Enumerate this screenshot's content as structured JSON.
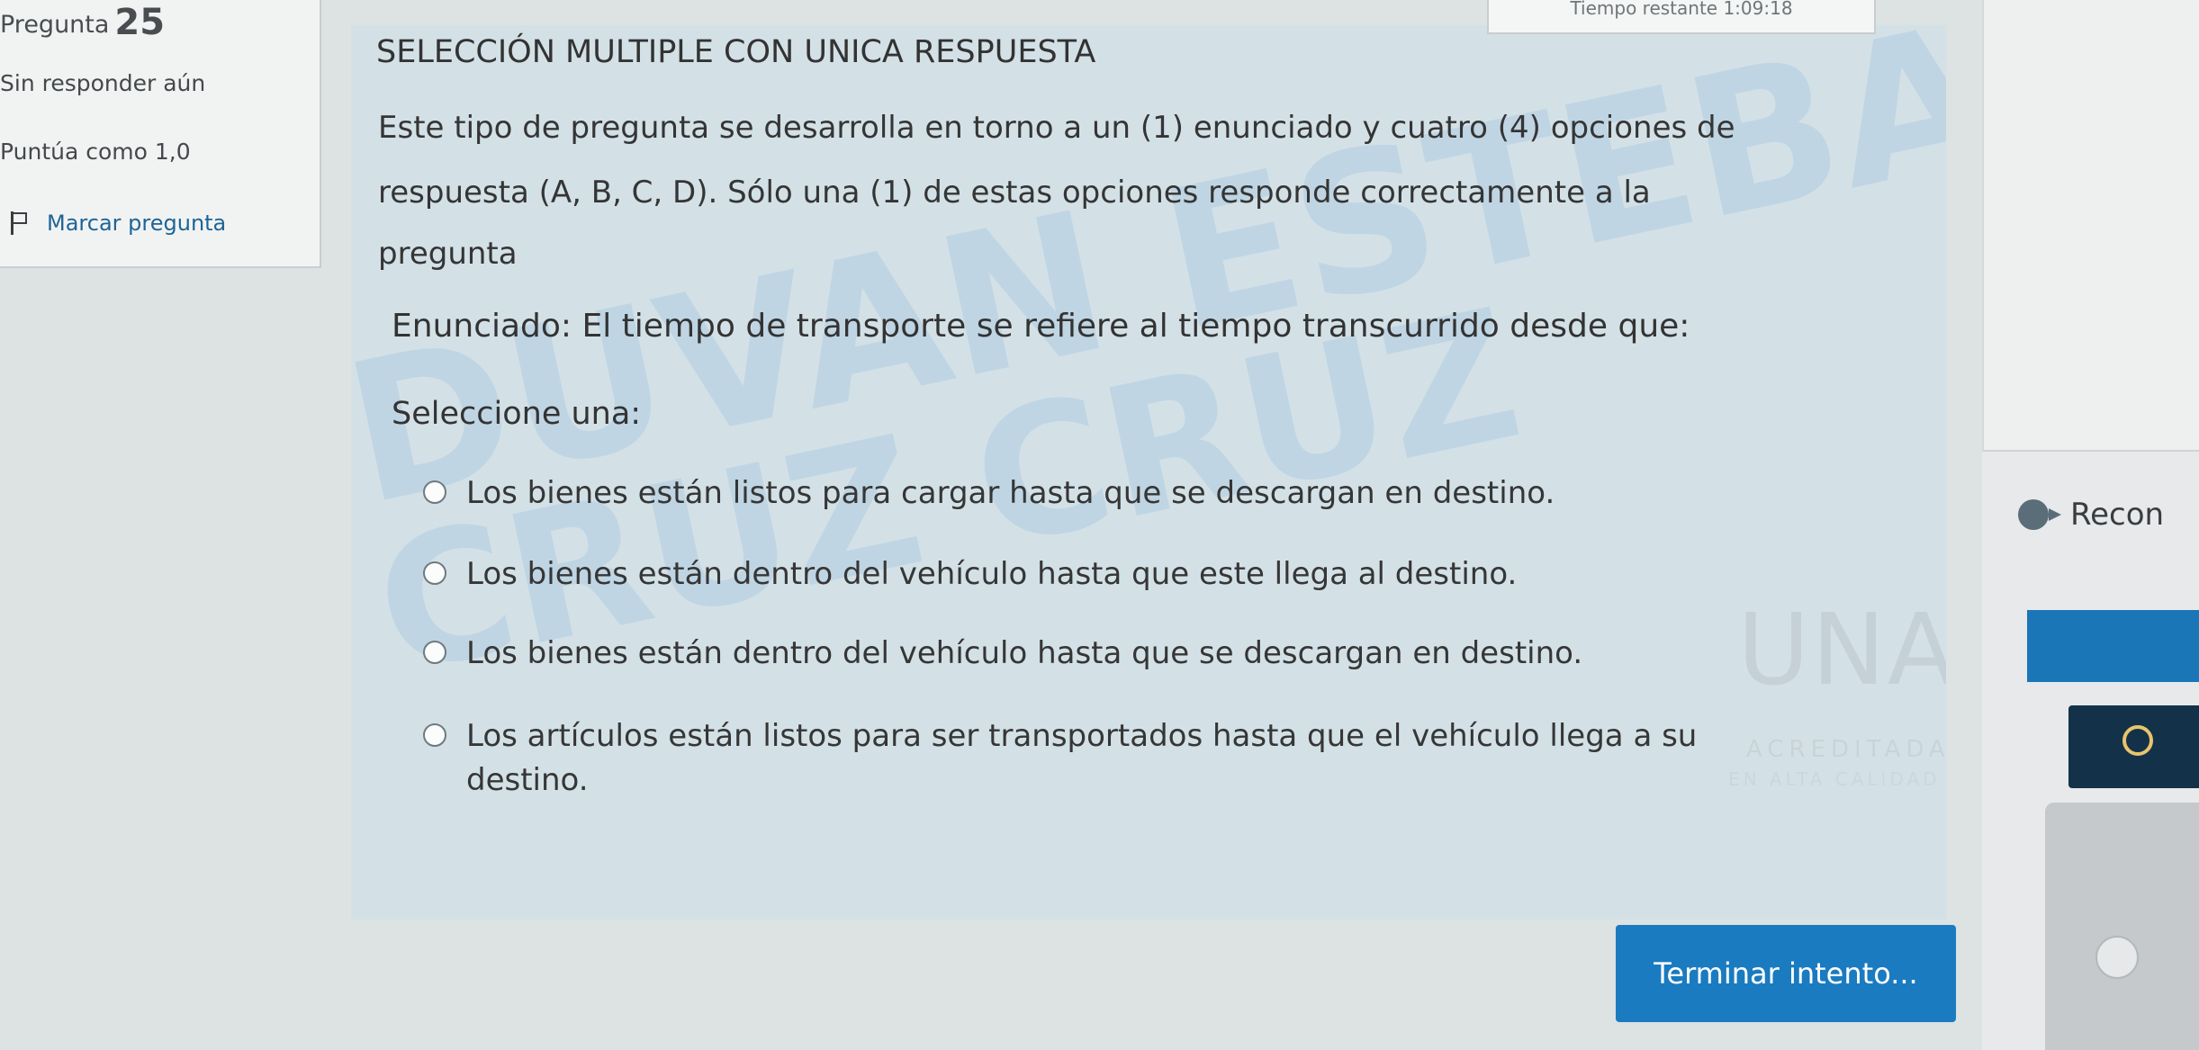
{
  "question": {
    "label": "Pregunta",
    "number": "25",
    "status": "Sin responder aún",
    "points": "Puntúa como 1,0",
    "flag_label": "Marcar pregunta"
  },
  "timer": {
    "label": "Tiempo restante 1:09:18"
  },
  "content": {
    "type_title": "SELECCIÓN MULTIPLE CON UNICA RESPUESTA",
    "description_lines": [
      "Este tipo de pregunta se desarrolla en torno a un (1) enunciado y cuatro (4) opciones de",
      "respuesta (A, B, C, D). Sólo una (1) de estas opciones responde correctamente a la",
      "pregunta"
    ],
    "statement": "Enunciado: El tiempo de transporte se refiere al tiempo transcurrido desde que:",
    "select_prompt": "Seleccione una:",
    "options": [
      "Los bienes están listos para cargar hasta que se descargan en destino.",
      "Los bienes están dentro del vehículo hasta que este llega al destino.",
      "Los bienes están dentro del vehículo hasta que se descargan en destino.",
      "Los artículos están listos para ser transportados hasta que el vehículo llega a su destino."
    ]
  },
  "watermark": {
    "line1": "DUVAN ESTEBAN",
    "line2": "CRUZ CRUZ",
    "logo_letters": "UNAD",
    "logo_caption": "ACREDITADA",
    "logo_subcaption": "EN ALTA CALIDAD"
  },
  "actions": {
    "finish_label": "Terminar intento..."
  },
  "sidebar": {
    "recon_label": "Recon"
  }
}
